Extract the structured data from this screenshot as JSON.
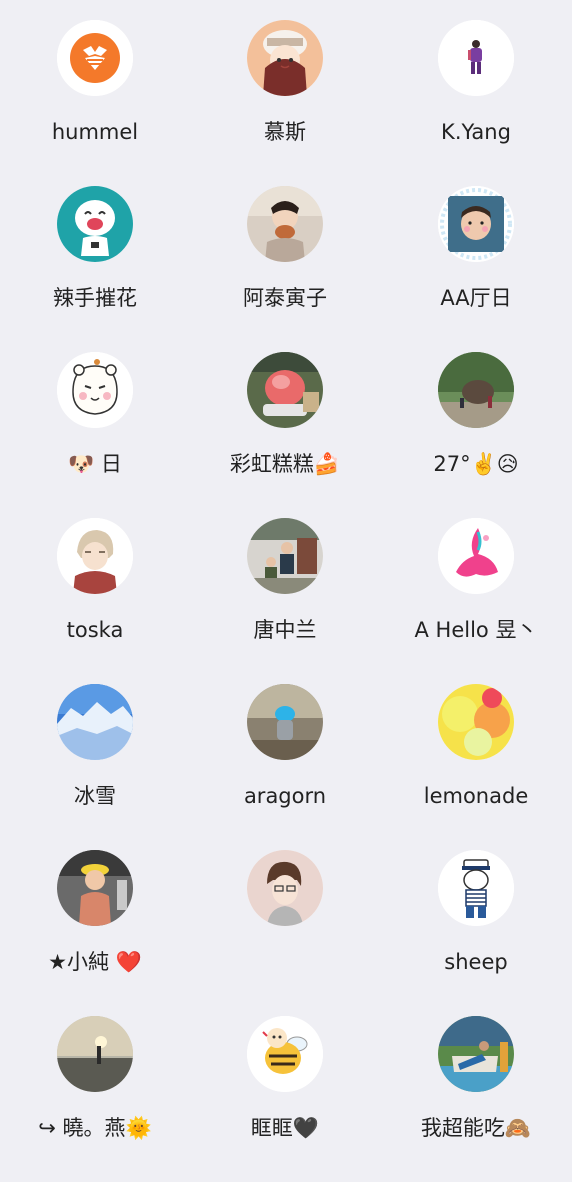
{
  "contacts": [
    {
      "name": "hummel",
      "avatar": "hummel-bee-logo-icon"
    },
    {
      "name": "慕斯",
      "avatar": "cartoon-girl-avatar"
    },
    {
      "name": "K.Yang",
      "avatar": "small-figure-avatar"
    },
    {
      "name": "辣手摧花",
      "avatar": "laughing-cartoon-avatar"
    },
    {
      "name": "阿泰寅子",
      "avatar": "child-eating-photo"
    },
    {
      "name": "AA厅日",
      "avatar": "baby-photo-avatar"
    },
    {
      "name": "🐶 日",
      "avatar": "white-bear-sticker-avatar"
    },
    {
      "name": "彩虹糕糕🍰",
      "avatar": "shaved-ice-photo"
    },
    {
      "name": "27°✌️😥",
      "avatar": "outdoor-scene-photo"
    },
    {
      "name": "toska",
      "avatar": "anime-boy-avatar"
    },
    {
      "name": "唐中兰",
      "avatar": "family-photo-avatar"
    },
    {
      "name": "A Hello 昱丶",
      "avatar": "pink-ink-avatar"
    },
    {
      "name": "冰雪",
      "avatar": "snowy-mountain-photo"
    },
    {
      "name": "aragorn",
      "avatar": "child-blue-hat-photo"
    },
    {
      "name": "lemonade",
      "avatar": "lemon-slices-photo"
    },
    {
      "name": "★小純 ❤️",
      "avatar": "girl-yellow-hat-photo"
    },
    {
      "name": "",
      "avatar": "boy-glasses-illustration"
    },
    {
      "name": "sheep",
      "avatar": "sailor-cat-sticker"
    },
    {
      "name": "↪ 曉。燕🌞",
      "avatar": "sunset-beach-photo"
    },
    {
      "name": "眶眶🖤",
      "avatar": "cartoon-bee-avatar"
    },
    {
      "name": "我超能吃🙈",
      "avatar": "man-reclining-photo"
    }
  ],
  "colors": {
    "background": "#efeff4",
    "hummel_orange": "#f4792a",
    "text": "#222222"
  }
}
